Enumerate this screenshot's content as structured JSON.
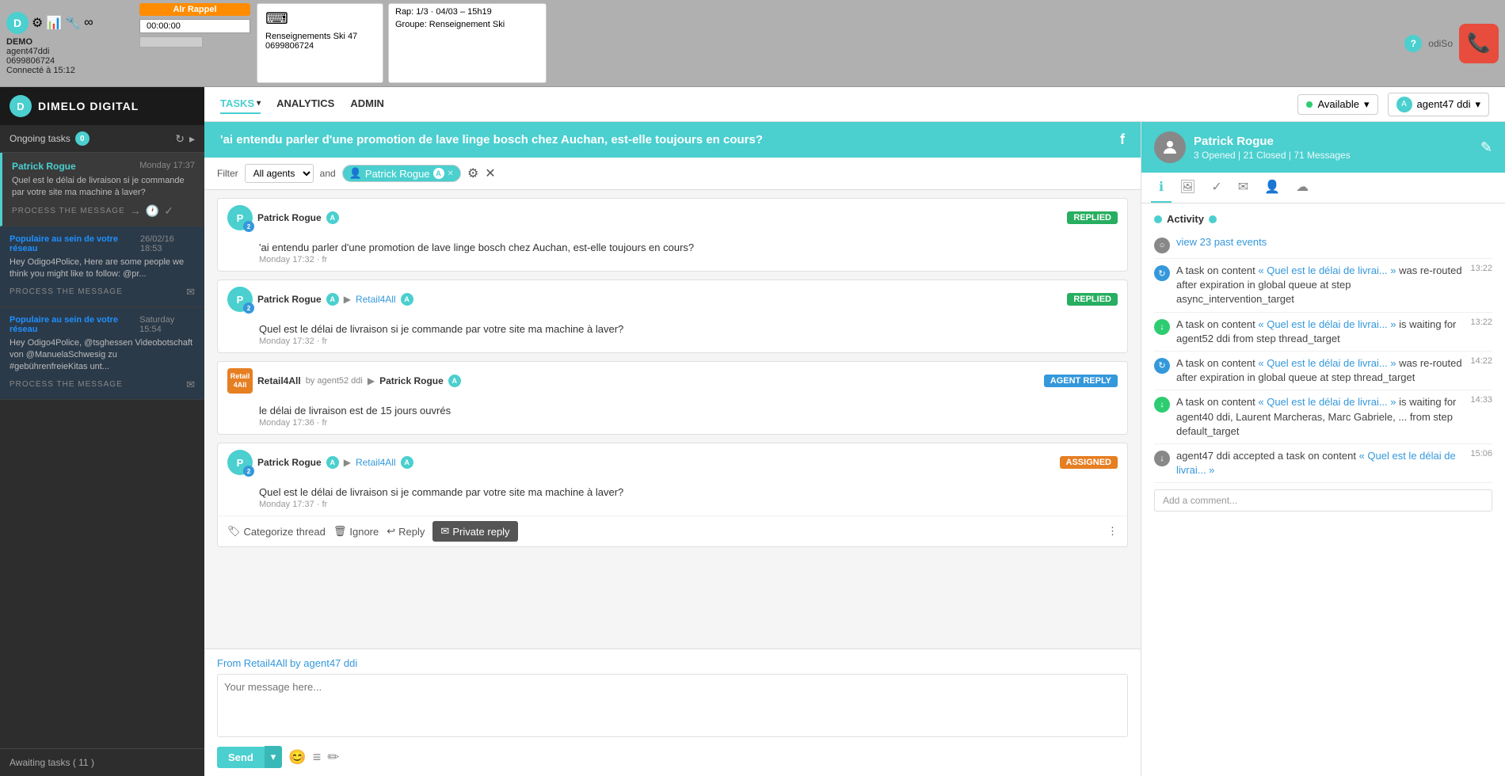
{
  "topBar": {
    "demo": "DEMO",
    "agent": "agent47ddi",
    "phone": "0699806724",
    "connected": "Connecté à 15:12",
    "recallLabel": "Alr Rappel",
    "timerLabel": "00:00:00",
    "rap": "Rap: 1/3 · 04/03 – 15h19",
    "renseignements": "Renseignements Ski 47",
    "phone2": "0699806724",
    "groupe": "Groupe: Renseignement Ski",
    "helpLabel": "?",
    "odiSo": "odiSo"
  },
  "nav": {
    "tasks": "TASKS",
    "analytics": "ANALYTICS",
    "admin": "ADMIN",
    "available": "Available",
    "agentLabel": "agent47 ddi"
  },
  "sidebar": {
    "brand": "DIMELO DIGITAL",
    "section": "Ongoing tasks",
    "sectionCount": "0",
    "tasks": [
      {
        "name": "Patrick Rogue",
        "date": "Monday 17:37",
        "msg": "Quel est le délai de livraison si je commande par votre site ma machine à laver?",
        "processLabel": "PROCESS THE MESSAGE",
        "active": true
      },
      {
        "name": "Populaire au sein de votre réseau",
        "date": "26/02/16 18:53",
        "msg": "Hey Odigo4Police, Here are some people we think you might like to follow: @pr...",
        "processLabel": "PROCESS THE MESSAGE",
        "active": false
      },
      {
        "name": "Populaire au sein de votre réseau",
        "date": "Saturday 15:54",
        "msg": "Hey Odigo4Police, @tsghessen Videobotschaft von @ManuelaSchwesig zu #gebührenfreieKitas unt...",
        "processLabel": "PROCESS THE MESSAGE",
        "active": false
      }
    ],
    "awaitingLabel": "Awaiting tasks ( 11 )"
  },
  "convo": {
    "title": "'ai entendu parler d'une promotion de lave linge bosch chez Auchan, est-elle toujours en cours?",
    "filterLabel": "Filter",
    "allAgents": "All agents",
    "and": "and",
    "agentFilter": "Patrick Rogue",
    "messages": [
      {
        "sender": "Patrick Rogue",
        "agentBadge": "A",
        "status": "REPLIED",
        "statusType": "replied",
        "text": "'ai entendu parler d'une promotion de lave linge bosch chez Auchan, est-elle toujours en cours?",
        "meta": "Monday 17:32 · fr",
        "hasArrow": false,
        "to": ""
      },
      {
        "sender": "Patrick Rogue",
        "agentBadge": "A",
        "status": "REPLIED",
        "statusType": "replied",
        "text": "Quel est le délai de livraison si je commande par votre site ma machine à laver?",
        "meta": "Monday 17:32 · fr",
        "hasArrow": true,
        "to": "Retail4All"
      },
      {
        "sender": "Retail4All",
        "agentLabel": "by agent52 ddi",
        "status": "AGENT REPLY",
        "statusType": "agent-reply",
        "text": "le délai de livraison est de 15 jours ouvrés",
        "meta": "Monday 17:36 · fr",
        "hasArrow": true,
        "to": "Patrick Rogue",
        "isRetail": true
      },
      {
        "sender": "Patrick Rogue",
        "agentBadge": "A",
        "status": "ASSIGNED",
        "statusType": "assigned",
        "text": "Quel est le délai de livraison si je commande par votre site ma machine à laver?",
        "meta": "Monday 17:37 · fr",
        "hasArrow": true,
        "to": "Retail4All",
        "showActions": true
      }
    ],
    "msgActions": {
      "categorize": "Categorize thread",
      "ignore": "Ignore",
      "reply": "Reply",
      "privateReply": "Private reply"
    },
    "reply": {
      "fromLabel": "From",
      "fromSource": "Retail4All",
      "fromAgent": "by agent47 ddi",
      "placeholder": "Your message here...",
      "sendLabel": "Send"
    }
  },
  "rightPanel": {
    "name": "Patrick Rogue",
    "stats": "3 Opened | 21 Closed | 71 Messages",
    "activityTitle": "Activity",
    "viewPastEvents": "view 23 past events",
    "activities": [
      {
        "iconType": "reroute",
        "text": "A task on content « Quel est le délai de livrai... » was re-routed after expiration in global queue at step async_intervention_target",
        "time": "13:22"
      },
      {
        "iconType": "waiting",
        "text": "A task on content « Quel est le délai de livrai... » is waiting for agent52 ddi from step thread_target",
        "time": "13:22"
      },
      {
        "iconType": "reroute",
        "text": "A task on content « Quel est le délai de livrai... » was re-routed after expiration in global queue at step thread_target",
        "time": "14:22"
      },
      {
        "iconType": "waiting",
        "text": "A task on content « Quel est le délai de livrai... » is waiting for agent40 ddi, Laurent Marcheras, Marc Gabriele, ... from step default_target",
        "time": "14:33"
      },
      {
        "iconType": "accepted",
        "text": "agent47 ddi accepted a task on content « Quel est le délai de livrai... »",
        "time": "15:06"
      }
    ],
    "commentPlaceholder": "Add a comment..."
  }
}
